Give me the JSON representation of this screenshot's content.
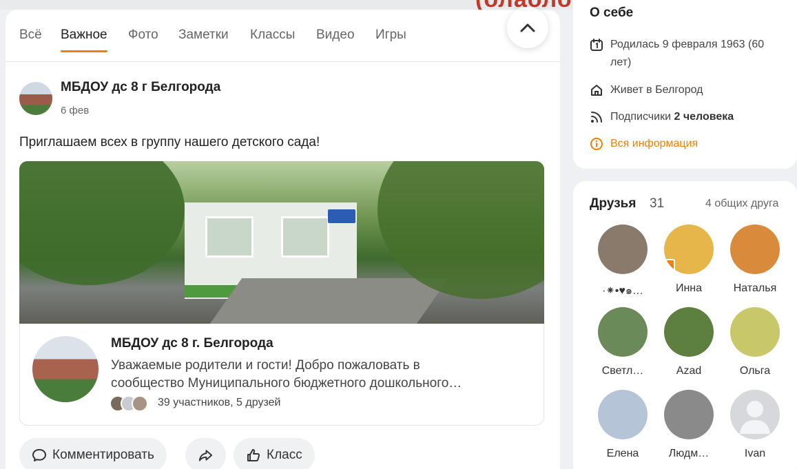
{
  "tabs": [
    {
      "label": "Всё"
    },
    {
      "label": "Важное"
    },
    {
      "label": "Фото"
    },
    {
      "label": "Заметки"
    },
    {
      "label": "Классы"
    },
    {
      "label": "Видео"
    },
    {
      "label": "Игры"
    }
  ],
  "post": {
    "author": "МБДОУ дс 8 г Белгорода",
    "date": "6 фев",
    "text": "Приглашаем всех в группу нашего детского сада!",
    "group": {
      "name": "МБДОУ дс 8 г. Белгорода",
      "desc_line1": "Уважаемые родители и гости! Добро пожаловать в",
      "desc_line2": "сообщество Муниципального бюджетного дошкольного…",
      "members": "39 участников, 5 друзей"
    },
    "actions": {
      "comment": "Комментировать",
      "like": "Класс"
    }
  },
  "about": {
    "title": "О себе",
    "born": "Родилась 9 февраля 1963 (60",
    "born_cont": "лет)",
    "lives": "Живет в Белгород",
    "subs_label": "Подписчики",
    "subs_value": "2 человека",
    "all_info": "Вся информация"
  },
  "friends": {
    "title": "Друзья",
    "count": "31",
    "mutual": "4 общих друга",
    "items": [
      {
        "name": "·⁕•♥๑…",
        "color": "#8a7a6c"
      },
      {
        "name": "Инна",
        "color": "#e6b64a"
      },
      {
        "name": "Наталья",
        "color": "#d98a3a"
      },
      {
        "name": "Светл…",
        "color": "#6b8a5a"
      },
      {
        "name": "Azad",
        "color": "#5d7f3f"
      },
      {
        "name": "Ольга",
        "color": "#c8c86a"
      },
      {
        "name": "Елена",
        "color": "#b6c4d8"
      },
      {
        "name": "Людм…",
        "color": "#8a8a8a"
      },
      {
        "name": "Ivan",
        "color": "#d6d8db"
      }
    ]
  },
  "colors": {
    "accent": "#ee8208"
  }
}
